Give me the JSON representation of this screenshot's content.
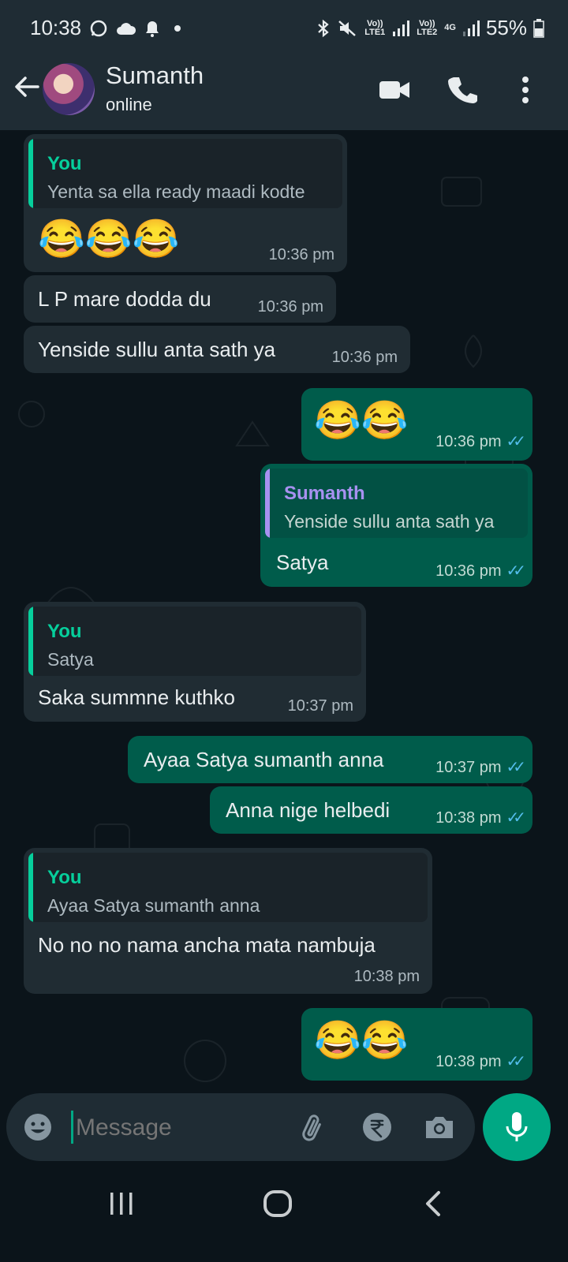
{
  "status_bar": {
    "time": "10:38",
    "battery": "55%",
    "sim1_label": "Vo)) LTE1",
    "sim2_label": "Vo)) LTE2",
    "net_label": "4G"
  },
  "header": {
    "contact_name": "Sumanth",
    "status": "online"
  },
  "messages": [
    {
      "dir": "in",
      "quote_name": "You",
      "quote_text": "Yenta sa ella ready maadi kodte",
      "body": "😂😂😂",
      "time": "10:36 pm"
    },
    {
      "dir": "in",
      "body": "L P mare dodda du",
      "time": "10:36 pm"
    },
    {
      "dir": "in",
      "body": "Yenside sullu anta sath ya",
      "time": "10:36 pm"
    },
    {
      "dir": "out",
      "body": "😂😂",
      "time": "10:36 pm",
      "read": true
    },
    {
      "dir": "out",
      "quote_name": "Sumanth",
      "quote_text": "Yenside sullu anta sath ya",
      "body": "Satya",
      "time": "10:36 pm",
      "read": true
    },
    {
      "dir": "in",
      "quote_name": "You",
      "quote_text": "Satya",
      "body": "Saka summne kuthko",
      "time": "10:37 pm"
    },
    {
      "dir": "out",
      "body": "Ayaa Satya sumanth anna",
      "time": "10:37 pm",
      "read": true
    },
    {
      "dir": "out",
      "body": "Anna nige helbedi",
      "time": "10:38 pm",
      "read": true
    },
    {
      "dir": "in",
      "quote_name": "You",
      "quote_text": "Ayaa Satya sumanth anna",
      "body": "No no no nama ancha mata nambuja",
      "time": "10:38 pm"
    },
    {
      "dir": "out",
      "body": "😂😂",
      "time": "10:38 pm",
      "read": true
    }
  ],
  "composer": {
    "placeholder": "Message"
  },
  "icons": {
    "header": [
      "back-arrow-icon",
      "video-call-icon",
      "phone-icon",
      "more-options-icon"
    ],
    "composer": [
      "emoji-icon",
      "attach-icon",
      "rupee-payment-icon",
      "camera-icon",
      "mic-icon"
    ],
    "nav": [
      "recent-apps-icon",
      "home-icon",
      "back-icon"
    ]
  },
  "colors": {
    "header_bg": "#1f2c34",
    "chat_bg": "#0b141a",
    "incoming_bubble": "#202c33",
    "outgoing_bubble": "#005c4b",
    "accent": "#00a884",
    "quote_you": "#06cf9c",
    "quote_contact": "#a791f0",
    "read_tick": "#53bdeb"
  }
}
